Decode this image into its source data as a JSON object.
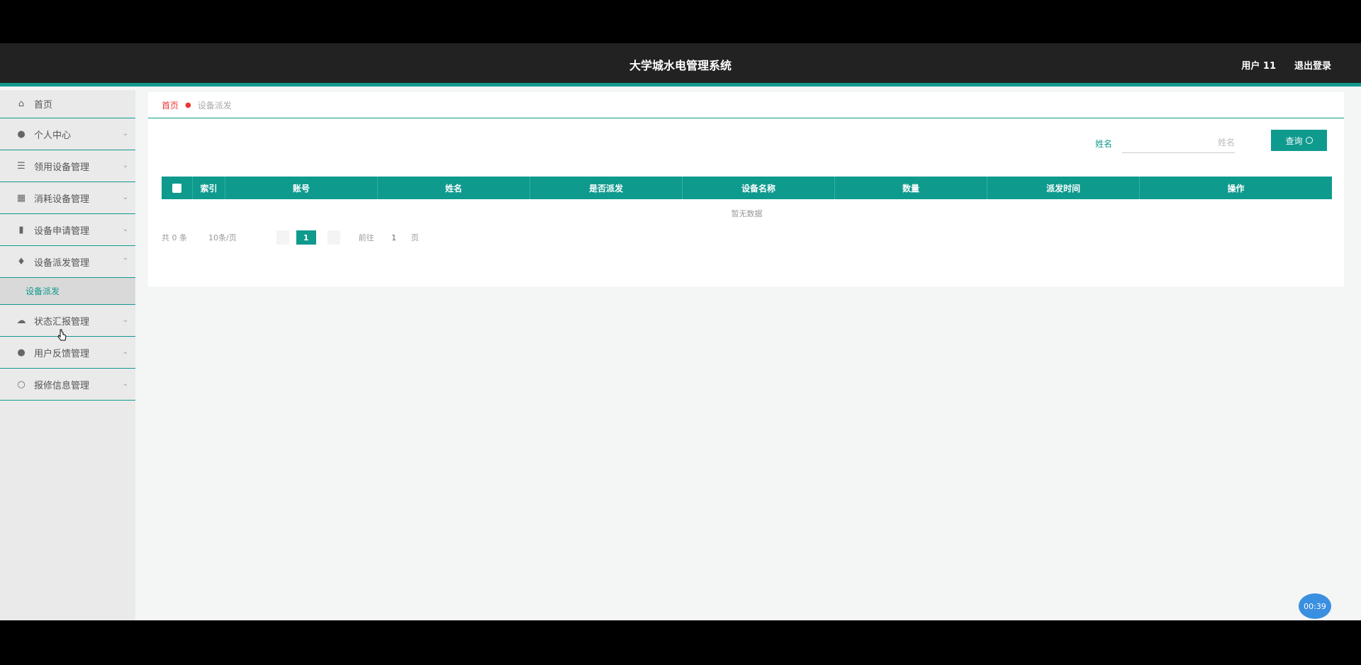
{
  "header": {
    "title": "大学城水电管理系统",
    "user": "用户 11",
    "logout": "退出登录"
  },
  "sidebar": {
    "items": [
      {
        "label": "首页",
        "icon": "home-icon"
      },
      {
        "label": "个人中心",
        "icon": "user-icon"
      },
      {
        "label": "领用设备管理",
        "icon": "stack-icon"
      },
      {
        "label": "消耗设备管理",
        "icon": "grid-icon"
      },
      {
        "label": "设备申请管理",
        "icon": "bar-chart-icon"
      },
      {
        "label": "设备派发管理",
        "icon": "pin-icon"
      },
      {
        "label": "状态汇报管理",
        "icon": "cloud-icon"
      },
      {
        "label": "用户反馈管理",
        "icon": "person-icon"
      },
      {
        "label": "报修信息管理",
        "icon": "circle-icon"
      }
    ],
    "active_sub": "设备派发"
  },
  "breadcrumb": {
    "home": "首页",
    "current": "设备派发"
  },
  "search": {
    "label": "姓名",
    "placeholder": "姓名",
    "button": "查询"
  },
  "table": {
    "columns": [
      "索引",
      "账号",
      "姓名",
      "是否派发",
      "设备名称",
      "数量",
      "派发时间",
      "操作"
    ],
    "empty": "暂无数据"
  },
  "pagination": {
    "total": "共 0 条",
    "page_size": "10条/页",
    "current_page": "1",
    "goto": "前往",
    "goto_value": "1",
    "page_unit": "页"
  },
  "timer": "00:39"
}
